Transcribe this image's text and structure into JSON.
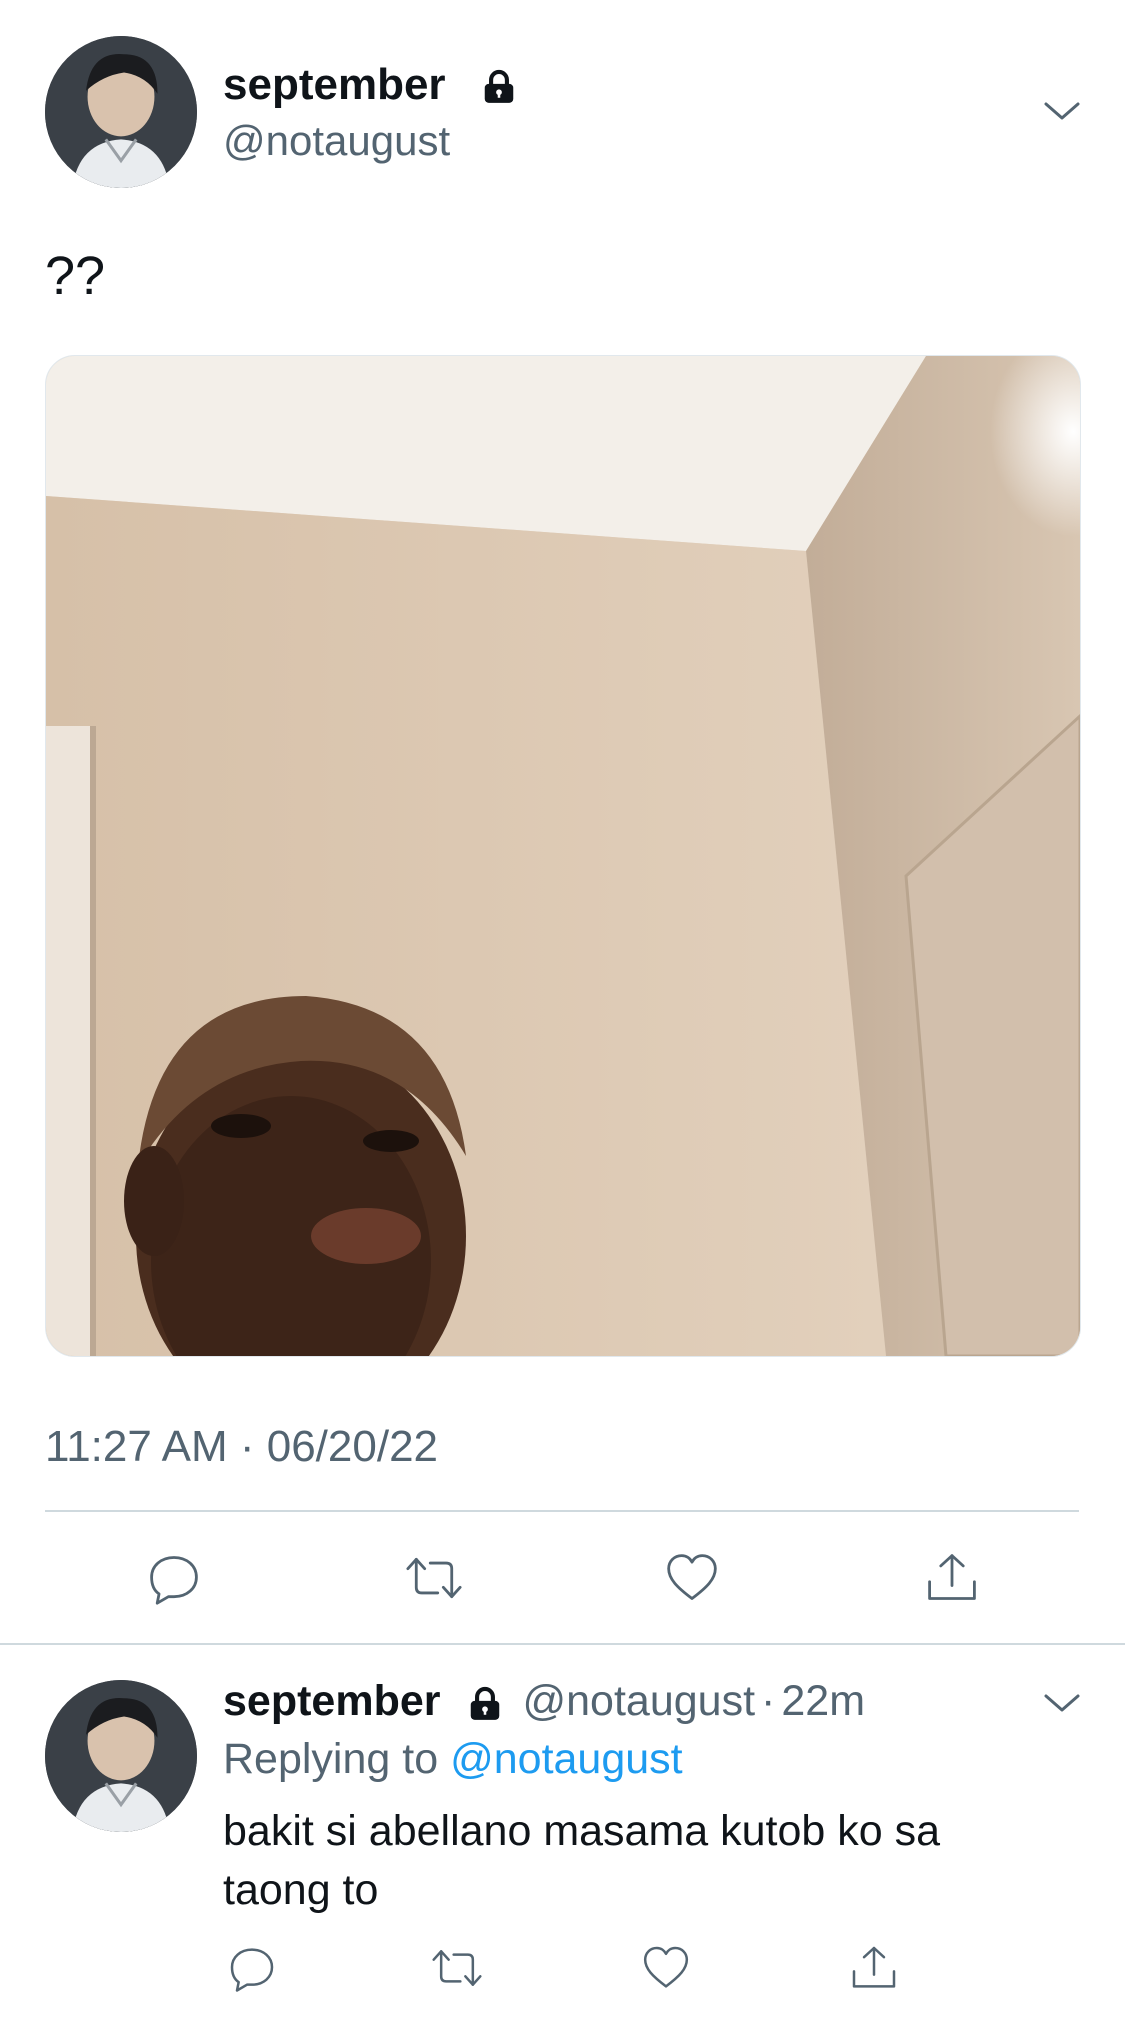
{
  "tweet": {
    "author_name": "september",
    "author_handle": "@notaugust",
    "text": "??",
    "timestamp": "11:27 AM · 06/20/22",
    "media_alt": "photo",
    "icons": {
      "lock": "lock-icon",
      "caret": "chevron-down-icon",
      "reply": "reply-icon",
      "retweet": "retweet-icon",
      "like": "heart-icon",
      "share": "share-icon"
    }
  },
  "reply": {
    "author_name": "september",
    "author_handle": "@notaugust",
    "separator": "·",
    "time_ago": "22m",
    "replying_prefix": "Replying to",
    "replying_handle": "@notaugust",
    "text": "bakit si abellano masama kutob ko sa taong to"
  },
  "colors": {
    "text": "#0f1419",
    "muted": "#536471",
    "link": "#1d9bf0",
    "divider": "#cfd9de"
  }
}
